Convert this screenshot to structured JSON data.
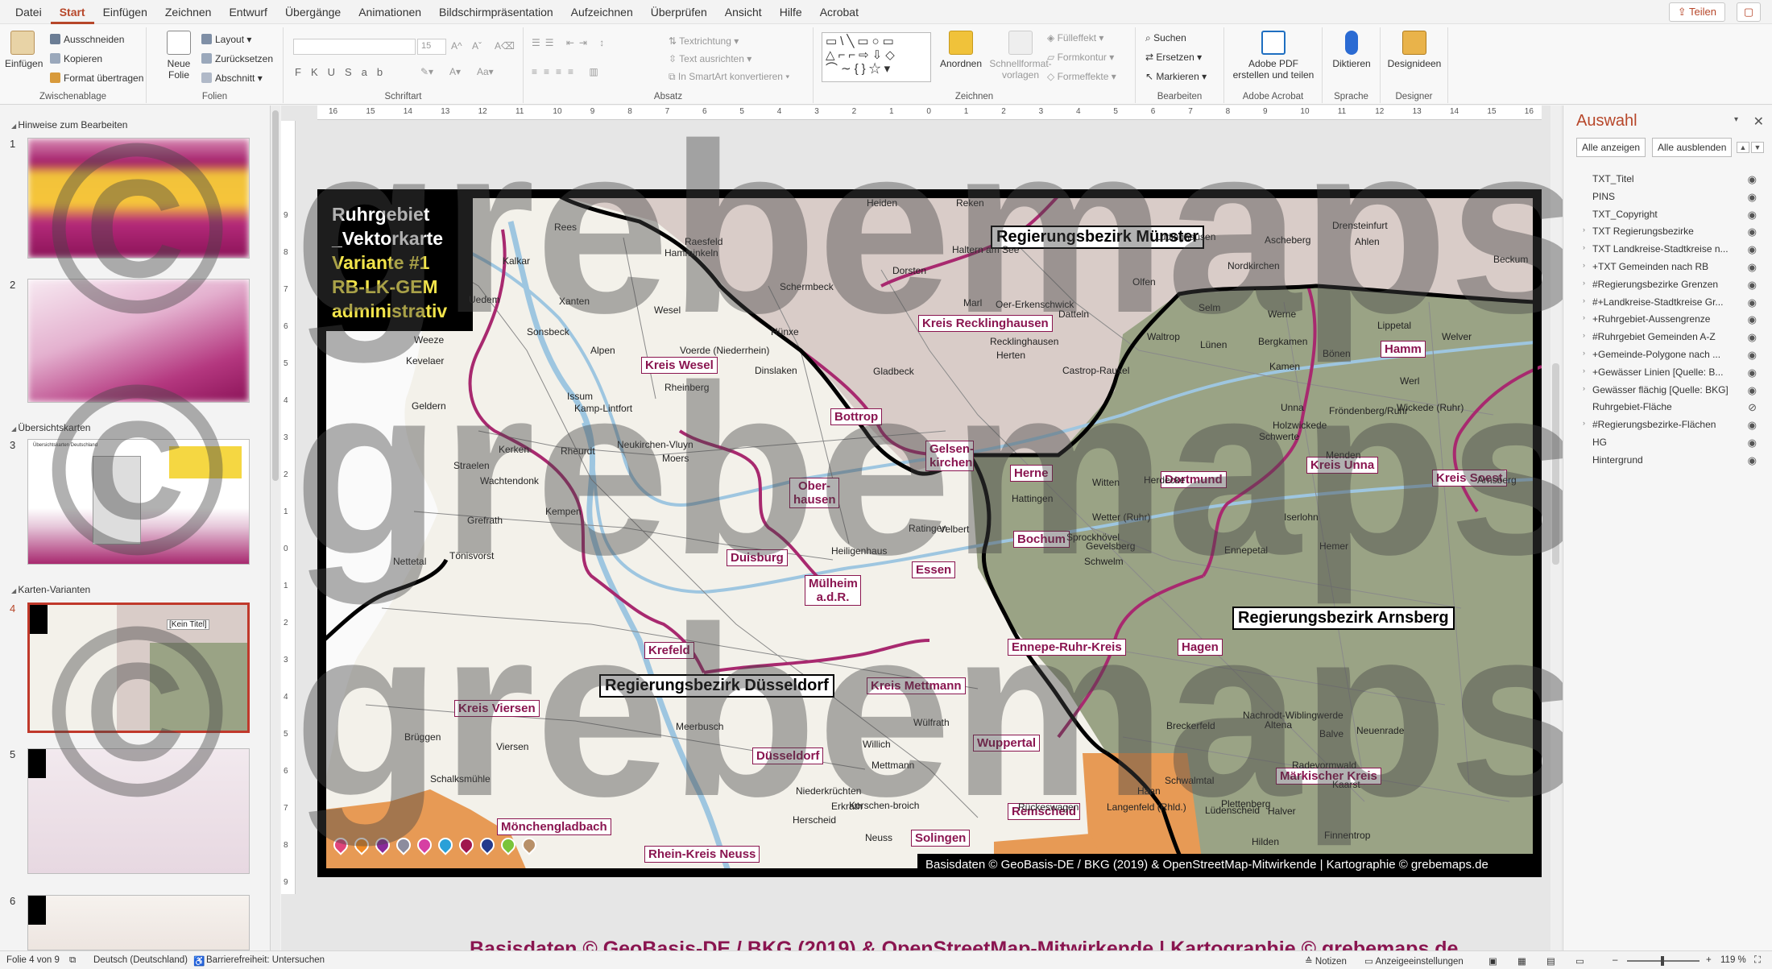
{
  "menu": {
    "tabs": [
      "Datei",
      "Start",
      "Einfügen",
      "Zeichnen",
      "Entwurf",
      "Übergänge",
      "Animationen",
      "Bildschirmpräsentation",
      "Aufzeichnen",
      "Überprüfen",
      "Ansicht",
      "Hilfe",
      "Acrobat"
    ],
    "active_tab": "Start",
    "share_label": "Teilen"
  },
  "ribbon": {
    "clipboard": {
      "paste": "Einfügen",
      "cut": "Ausschneiden",
      "copy": "Kopieren",
      "format_painter": "Format übertragen",
      "label": "Zwischenablage"
    },
    "slides": {
      "new_slide_1": "Neue",
      "new_slide_2": "Folie",
      "layout": "Layout",
      "reset": "Zurücksetzen",
      "section": "Abschnitt",
      "label": "Folien"
    },
    "font": {
      "size": "15",
      "label": "Schriftart"
    },
    "paragraph": {
      "text_direction": "Textrichtung",
      "align_text": "Text ausrichten",
      "smartart": "In SmartArt konvertieren",
      "label": "Absatz"
    },
    "drawing": {
      "arrange": "Anordnen",
      "quick_styles_1": "Schnellformat-",
      "quick_styles_2": "vorlagen",
      "fill": "Fülleffekt",
      "outline": "Formkontur",
      "effects": "Formeffekte",
      "label": "Zeichnen"
    },
    "editing": {
      "find": "Suchen",
      "replace": "Ersetzen",
      "select": "Markieren",
      "label": "Bearbeiten"
    },
    "acrobat": {
      "create_1": "Adobe PDF",
      "create_2": "erstellen und teilen",
      "label": "Adobe Acrobat"
    },
    "voice": {
      "dictate": "Diktieren",
      "label": "Sprache"
    },
    "designer": {
      "ideas": "Designideen",
      "label": "Designer"
    }
  },
  "thumbnails": {
    "sections": [
      "Hinweise zum Bearbeiten",
      "Übersichtskarten",
      "Karten-Varianten"
    ],
    "numbers": [
      "1",
      "2",
      "3",
      "4",
      "5",
      "6"
    ],
    "slide3_title": "Übersichtskarten Deutschland",
    "slide4_badge": "[Kein Titel]"
  },
  "rulers": {
    "h": [
      "16",
      "15",
      "14",
      "13",
      "12",
      "11",
      "10",
      "9",
      "8",
      "7",
      "6",
      "5",
      "4",
      "3",
      "2",
      "1",
      "0",
      "1",
      "2",
      "3",
      "4",
      "5",
      "6",
      "7",
      "8",
      "9",
      "10",
      "11",
      "12",
      "13",
      "14",
      "15",
      "16"
    ],
    "v": [
      "9",
      "8",
      "7",
      "6",
      "5",
      "4",
      "3",
      "2",
      "1",
      "0",
      "1",
      "2",
      "3",
      "4",
      "5",
      "6",
      "7",
      "8",
      "9"
    ]
  },
  "slide": {
    "title_lines": [
      "Ruhrgebiet",
      "_Vektorkarte"
    ],
    "subtitle_lines": [
      "Variante #1",
      "RB-LK-GEM",
      "administrativ"
    ],
    "regierungsbezirke": [
      "Regierungsbezirk Münster",
      "Regierungsbezirk Düsseldorf",
      "Regierungsbezirk Arnsberg"
    ],
    "kreise": [
      "Kreis Wesel",
      "Kreis Recklinghausen",
      "Bottrop",
      "Gelsen-kirchen",
      "Ober-hausen",
      "Duisburg",
      "Mülheim a.d.R.",
      "Essen",
      "Herne",
      "Bochum",
      "Dortmund",
      "Kreis Unna",
      "Hamm",
      "Kreis Soest",
      "Ennepe-Ruhr-Kreis",
      "Hagen",
      "Krefeld",
      "Kreis Mettmann",
      "Kreis Viersen",
      "Wuppertal",
      "Düsseldorf",
      "Remscheid",
      "Mönchengladbach",
      "Solingen",
      "Rhein-Kreis Neuss",
      "Märkischer Kreis"
    ],
    "gemeinden": [
      "Heiden",
      "Reken",
      "Drensteinfurt",
      "Rees",
      "Raesfeld",
      "Haltern am See",
      "Lüdinghausen",
      "Ascheberg",
      "Ahlen",
      "Hamminkeln",
      "Kalkar",
      "Dorsten",
      "Nordkirchen",
      "Beckum",
      "Schermbeck",
      "Olfen",
      "Uedem",
      "Xanten",
      "Wesel",
      "Marl",
      "Oer-Erkenschwick",
      "Datteln",
      "Selm",
      "Werne",
      "Lippetal",
      "Sonsbeck",
      "Hünxe",
      "Recklinghausen",
      "Waltrop",
      "Lünen",
      "Bergkamen",
      "Welver",
      "Weeze",
      "Alpen",
      "Voerde (Niederrhein)",
      "Herten",
      "Kevelaer",
      "Dinslaken",
      "Gladbeck",
      "Castrop-Rauxel",
      "Kamen",
      "Bönen",
      "Rheinberg",
      "Werl",
      "Issum",
      "Kamp-Lintfort",
      "Geldern",
      "Unna",
      "Holzwickede",
      "Fröndenberg/Ruhr",
      "Wickede (Ruhr)",
      "Kerken",
      "Rheurdt",
      "Neukirchen-Vluyn",
      "Moers",
      "Schwerte",
      "Menden",
      "Straelen",
      "Wachtendonk",
      "Witten",
      "Herdecke",
      "Arnsberg",
      "Hattingen",
      "Kempen",
      "Wetter (Ruhr)",
      "Iserlohn",
      "Grefrath",
      "Sprockhövel",
      "Gevelsberg",
      "Hemer",
      "Tönisvorst",
      "Heiligenhaus",
      "Velbert",
      "Ratingen",
      "Nettetal",
      "Schwelm",
      "Ennepetal",
      "Nachrodt-Wiblingwerde",
      "Altena",
      "Balve",
      "Meerbusch",
      "Wülfrath",
      "Brüggen",
      "Viersen",
      "Willich",
      "Breckerfeld",
      "Neuenrade",
      "Mettmann",
      "Schalksmühle",
      "Schwalmtal",
      "Niederkrüchten",
      "Erkrath",
      "Radevormwald",
      "Kaarst",
      "Korschen-broich",
      "Haan",
      "Lüdenscheid",
      "Plettenberg",
      "Halver",
      "Hilden",
      "Neuss",
      "Finnentrop",
      "Herscheid",
      "Rückeswagen",
      "Langenfeld (Rhld.)"
    ],
    "credit": "Basisdaten © GeoBasis-DE / BKG (2019) & OpenStreetMap-Mitwirkende | Kartographie © grebemaps.de"
  },
  "watermark": {
    "line1": "© grebemaps",
    "line2": "© grebemaps",
    "line3": "© grebemaps",
    "bottom_credit": "Basisdaten © GeoBasis-DE / BKG (2019) & OpenStreetMap-Mitwirkende | Kartographie © grebemaps.de"
  },
  "selection_pane": {
    "title": "Auswahl",
    "show_all": "Alle anzeigen",
    "hide_all": "Alle ausblenden",
    "items": [
      "TXT_Titel",
      "PINS",
      "TXT_Copyright",
      "TXT Regierungsbezirke",
      "TXT Landkreise-Stadtkreise n...",
      "+TXT Gemeinden nach RB",
      "#Regierungsbezirke Grenzen",
      "#+Landkreise-Stadtkreise Gr...",
      "+Ruhrgebiet-Aussengrenze",
      "#Ruhrgebiet Gemeinden A-Z",
      "+Gemeinde-Polygone nach ...",
      "+Gewässer Linien [Quelle: B...",
      "Gewässer flächig [Quelle: BKG]",
      "Ruhrgebiet-Fläche",
      "#Regierungsbezirke-Flächen",
      "HG",
      "Hintergrund"
    ]
  },
  "status": {
    "slide_of": "Folie 4 von 9",
    "language": "Deutsch (Deutschland)",
    "accessibility": "Barrierefreiheit: Untersuchen",
    "notes": "Notizen",
    "display_settings": "Anzeigeeinstellungen",
    "zoom": "119 %"
  },
  "colors": {
    "accent": "#b7472a",
    "kreis_border": "#8a1550",
    "rb_duesseldorf": "#f3f1ea",
    "rb_muenster": "#d9ccc8",
    "rb_arnsberg": "#9aa385",
    "water": "#9ec6e0"
  },
  "pins_colors": [
    "#e0457b",
    "#f08a24",
    "#8a2a9a",
    "#8c8c9e",
    "#d63fa3",
    "#2aa0d8",
    "#a0174e",
    "#233a8c",
    "#7ac43a",
    "#b89068"
  ]
}
